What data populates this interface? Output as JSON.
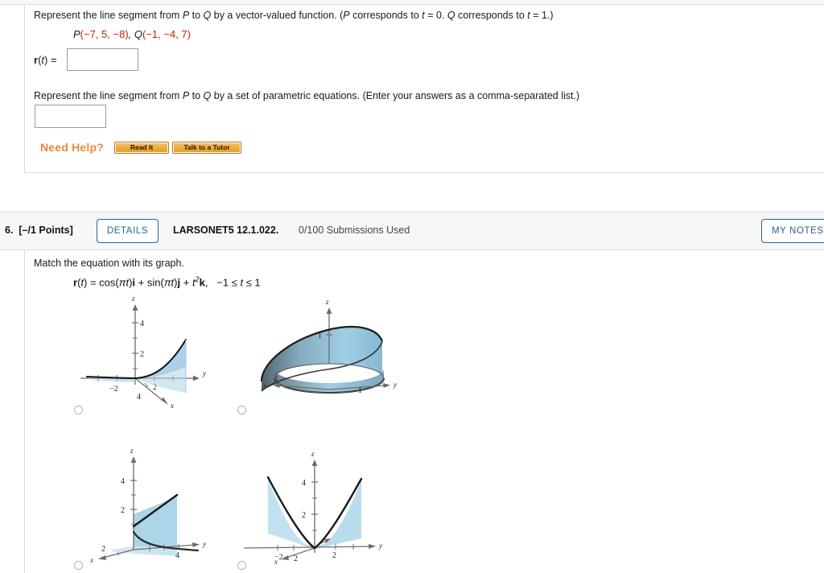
{
  "question5": {
    "prompt1": "Represent the line segment from P to Q by a vector-valued function. (P corresponds to t = 0. Q corresponds to t = 1.)",
    "points": "P(−7, 5, −8), Q(−1, −4, 7)",
    "point_p_label": "P",
    "point_p_coords": "(−7, 5, −8)",
    "point_q_label": "Q",
    "point_q_coords": "(−1, −4, 7)",
    "rt_label": "r(t) =",
    "answer1_value": "",
    "prompt2": "Represent the line segment from P to Q by a set of parametric equations. (Enter your answers as a comma-separated list.)",
    "answer2_value": "",
    "need_help_label": "Need Help?",
    "read_it_label": "Read It",
    "talk_tutor_label": "Talk to a Tutor"
  },
  "question6": {
    "number": "6.",
    "points": "[–/1 Points]",
    "details_label": "DETAILS",
    "code": "LARSONET5 12.1.022.",
    "submissions": "0/100 Submissions Used",
    "my_notes_label": "MY NOTES",
    "prompt": "Match the equation with its graph.",
    "equation": "r(t) = cos(πt)i + sin(πt)j + t²k,   −1 ≤ t ≤ 1",
    "equation_domain": "−1 ≤ t ≤ 1",
    "options": [
      {
        "id": "option-a",
        "selected": false,
        "axis_labels": {
          "x": "x",
          "y": "y",
          "z": "z"
        },
        "tick_labels": {
          "z": [
            "2",
            "4"
          ],
          "y": [
            "−2",
            "2"
          ],
          "x": [
            "4"
          ]
        },
        "description": "exponential-like curve rising in z with shaded surface, z axis ticks 2 and 4"
      },
      {
        "id": "option-b",
        "selected": false,
        "axis_labels": {
          "x": "x",
          "y": "y",
          "z": "z"
        },
        "tick_labels": {
          "z": [
            "1"
          ],
          "y": [
            "1"
          ],
          "x": [
            "1"
          ]
        },
        "description": "helical cylinder surface opening upward, ticks at 1"
      },
      {
        "id": "option-c",
        "selected": false,
        "axis_labels": {
          "x": "x",
          "y": "y",
          "z": "z"
        },
        "tick_labels": {
          "z": [
            "2",
            "4"
          ],
          "y": [
            "4"
          ],
          "x": [
            "2"
          ]
        },
        "description": "straight line rising with vertical shaded plane"
      },
      {
        "id": "option-d",
        "selected": false,
        "axis_labels": {
          "x": "x",
          "y": "y",
          "z": "z"
        },
        "tick_labels": {
          "z": [
            "2",
            "4"
          ],
          "y": [
            "−2",
            "2"
          ],
          "x": [
            "2"
          ]
        },
        "description": "parabola opening upward in the yz plane with shaded wings"
      }
    ]
  },
  "colors": {
    "accent_blue": "#2a6496",
    "help_orange": "#e8883a",
    "red_value": "#cc2200",
    "surface_blue": "#8ec4dd",
    "header_bg": "#f7f7f7"
  }
}
